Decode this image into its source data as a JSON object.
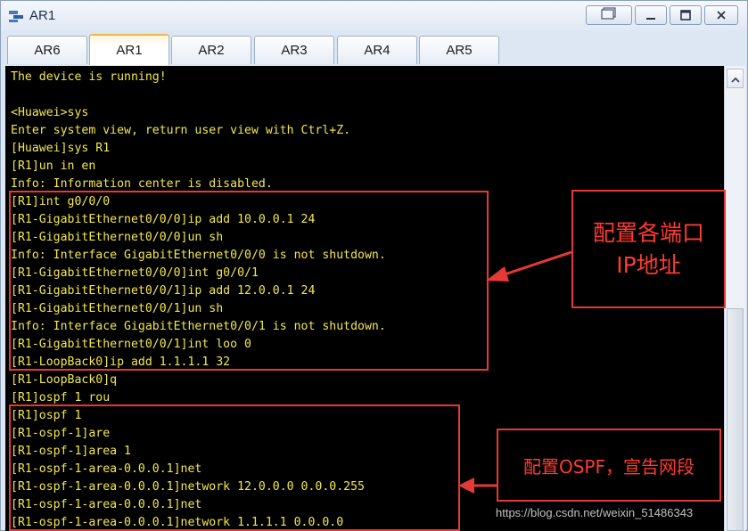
{
  "window": {
    "title": "AR1",
    "icon": "router-icon",
    "controls": {
      "restore_icon": "restore-windows-icon",
      "minimize_label": "—",
      "maximize_label": "☐",
      "close_label": "X"
    }
  },
  "tabs": [
    {
      "label": "AR6",
      "active": false
    },
    {
      "label": "AR1",
      "active": true
    },
    {
      "label": "AR2",
      "active": false
    },
    {
      "label": "AR3",
      "active": false
    },
    {
      "label": "AR4",
      "active": false
    },
    {
      "label": "AR5",
      "active": false
    }
  ],
  "terminal": {
    "text_color": "#f2e84d",
    "background": "#000000",
    "lines": [
      "The device is running!",
      "",
      "<Huawei>sys",
      "Enter system view, return user view with Ctrl+Z.",
      "[Huawei]sys R1",
      "[R1]un in en",
      "Info: Information center is disabled.",
      "[R1]int g0/0/0",
      "[R1-GigabitEthernet0/0/0]ip add 10.0.0.1 24",
      "[R1-GigabitEthernet0/0/0]un sh",
      "Info: Interface GigabitEthernet0/0/0 is not shutdown.",
      "[R1-GigabitEthernet0/0/0]int g0/0/1",
      "[R1-GigabitEthernet0/0/1]ip add 12.0.0.1 24",
      "[R1-GigabitEthernet0/0/1]un sh",
      "Info: Interface GigabitEthernet0/0/1 is not shutdown.",
      "[R1-GigabitEthernet0/0/1]int loo 0",
      "[R1-LoopBack0]ip add 1.1.1.1 32",
      "[R1-LoopBack0]q",
      "[R1]ospf 1 rou",
      "[R1]ospf 1",
      "[R1-ospf-1]are",
      "[R1-ospf-1]area 1",
      "[R1-ospf-1-area-0.0.0.1]net",
      "[R1-ospf-1-area-0.0.0.1]network 12.0.0.0 0.0.0.255",
      "[R1-ospf-1-area-0.0.0.1]net",
      "[R1-ospf-1-area-0.0.0.1]network 1.1.1.1 0.0.0.0"
    ]
  },
  "annotations": {
    "color": "#e53935",
    "note_port_config_line1": "配置各端口",
    "note_port_config_line2": "IP地址",
    "note_ospf_config": "配置OSPF，宣告网段"
  },
  "scrollbar": {
    "up_icon": "chevron-up-icon"
  },
  "watermark": "https://blog.csdn.net/weixin_51486343"
}
